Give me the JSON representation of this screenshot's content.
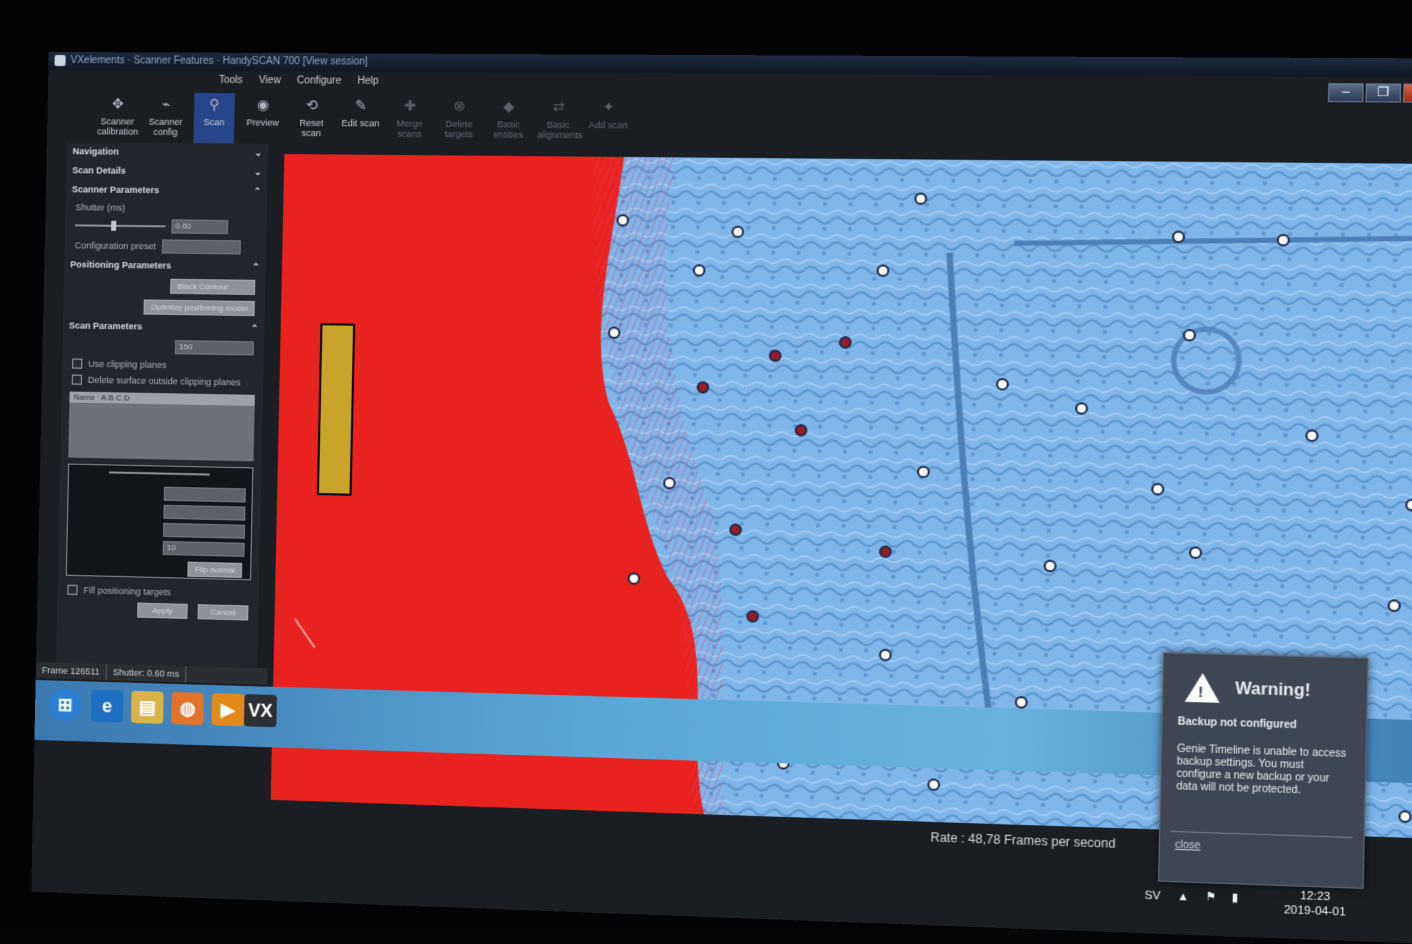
{
  "window": {
    "title": "VXelements · Scanner Features · HandySCAN 700 [View session]",
    "controls": {
      "minimize": "–",
      "maximize": "❐",
      "close": "✕"
    }
  },
  "menu": [
    "Tools",
    "View",
    "Configure",
    "Help"
  ],
  "ribbon": [
    {
      "label": "Scanner calibration",
      "icon": "crosshair-icon",
      "glyph": "✥",
      "state": "normal"
    },
    {
      "label": "Scanner config",
      "icon": "scanner-icon",
      "glyph": "⌁",
      "state": "normal"
    },
    {
      "label": "Scan",
      "icon": "scan-icon",
      "glyph": "⚲",
      "state": "active"
    },
    {
      "label": "Preview",
      "icon": "preview-icon",
      "glyph": "◉",
      "state": "normal"
    },
    {
      "label": "Reset scan",
      "icon": "reset-icon",
      "glyph": "⟲",
      "state": "normal"
    },
    {
      "label": "Edit scan",
      "icon": "edit-icon",
      "glyph": "✎",
      "state": "normal"
    },
    {
      "label": "Merge scans",
      "icon": "merge-icon",
      "glyph": "✚",
      "state": "disabled"
    },
    {
      "label": "Delete targets",
      "icon": "delete-targets-icon",
      "glyph": "⊗",
      "state": "disabled"
    },
    {
      "label": "Basic entities",
      "icon": "entities-icon",
      "glyph": "◆",
      "state": "disabled"
    },
    {
      "label": "Basic alignments",
      "icon": "alignment-icon",
      "glyph": "⇄",
      "state": "disabled"
    },
    {
      "label": "Add scan",
      "icon": "add-scan-icon",
      "glyph": "✦",
      "state": "disabled"
    }
  ],
  "panel": {
    "navigation": "Navigation",
    "scan_details": "Scan Details",
    "scanner_parameters": "Scanner Parameters",
    "shutter_label": "Shutter (ms)",
    "shutter_value": "0.60",
    "config_preset_label": "Configuration preset",
    "positioning_parameters": "Positioning Parameters",
    "positioning_mode": "Black Contour",
    "optimize_button": "Optimize positioning model",
    "scan_parameters": "Scan Parameters",
    "resolution_value": "150",
    "use_clipping": "Use clipping planes",
    "delete_surface": "Delete surface outside clipping planes",
    "name_header": "Name",
    "name_value": "A B C D",
    "target_fields": [
      "",
      "",
      "",
      "10"
    ],
    "flip_button": "Flip normal",
    "fill_targets": "Fill positioning targets",
    "apply_button": "Apply",
    "cancel_button": "Cancel"
  },
  "status": {
    "frame": "Frame 126511",
    "shutter": "Shutter: 0.60 ms"
  },
  "viewport": {
    "rate": "Rate : 48,78 Frames per second",
    "colors": {
      "background": "#e8231f",
      "surface": "#7fb6ea",
      "target_fill": "#ffffff",
      "target_ring": "#1c2a4a",
      "target_red": "#9b1b2b"
    }
  },
  "toast": {
    "title": "Warning!",
    "subtitle": "Backup not configured",
    "message": "Genie Timeline is unable to access backup settings. You must configure a new backup or your data will not be protected.",
    "close": "close"
  },
  "tray": {
    "language": "SV",
    "time": "12:23",
    "date": "2019-04-01"
  },
  "taskbar": [
    {
      "icon": "start-orb-icon",
      "glyph": "⊞"
    },
    {
      "icon": "internet-explorer-icon",
      "glyph": "e"
    },
    {
      "icon": "folder-icon",
      "glyph": "▤"
    },
    {
      "icon": "firefox-icon",
      "glyph": "◍"
    },
    {
      "icon": "media-player-icon",
      "glyph": "▶"
    },
    {
      "icon": "vxelements-icon",
      "glyph": "VX"
    }
  ]
}
